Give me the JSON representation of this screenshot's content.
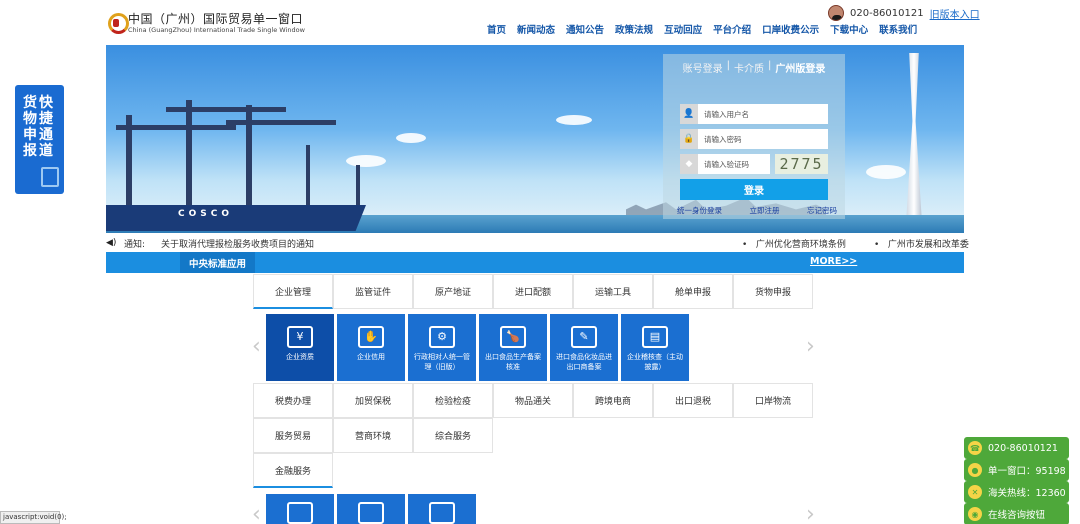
{
  "header": {
    "logo_cn": "中国（广州）国际贸易单一窗口",
    "logo_en": "China (GuangZhou) International Trade Single Window",
    "phone": "020-86010121",
    "old_version": "旧版本入口"
  },
  "nav": [
    "首页",
    "新闻动态",
    "通知公告",
    "政策法规",
    "互动回应",
    "平台介绍",
    "口岸收费公示",
    "下载中心",
    "联系我们"
  ],
  "banner": {
    "ship_text": "COSCO"
  },
  "login": {
    "tabs": [
      "账号登录",
      "卡介质",
      "广州版登录"
    ],
    "separator": "|",
    "username_placeholder": "请输入用户名",
    "password_placeholder": "请输入密码",
    "captcha_placeholder": "请输入验证码",
    "captcha": "2775",
    "button": "登录",
    "links": [
      "统一身份登录",
      "立即注册",
      "忘记密码"
    ]
  },
  "notice": {
    "label": "通知:",
    "message": "关于取消代理报检服务收费项目的通知",
    "right1": "广州优化营商环境条例",
    "right2": "广州市发展和改革委"
  },
  "section": {
    "tab": "中央标准应用",
    "more": "MORE>>"
  },
  "categories_row1": [
    "企业管理",
    "监管证件",
    "原产地证",
    "进口配额",
    "运输工具",
    "舱单申报",
    "货物申报"
  ],
  "tiles": [
    {
      "label": "企业资质",
      "icon": "¥"
    },
    {
      "label": "企业信用",
      "icon": "✋"
    },
    {
      "label": "行政相对人统一管理（旧版）",
      "icon": "⚙"
    },
    {
      "label": "出口食品生产备案核准",
      "icon": "🍗"
    },
    {
      "label": "进口食品化妆品进出口商备案",
      "icon": "✎"
    },
    {
      "label": "企业稽核查（主动披露）",
      "icon": "▤"
    }
  ],
  "categories_row2": [
    "税费办理",
    "加贸保税",
    "检验检疫",
    "物品通关",
    "跨境电商",
    "出口退税",
    "口岸物流"
  ],
  "categories_row3": [
    "服务贸易",
    "营商环境",
    "综合服务"
  ],
  "categories_row4": [
    "金融服务"
  ],
  "left_badge": {
    "col1": "快捷通道",
    "col2": "货物申报"
  },
  "side_buttons": [
    "020-86010121",
    "单一窗口：95198",
    "海关热线：12360",
    "在线咨询按钮"
  ],
  "statusbar": "javascript:void(0);"
}
